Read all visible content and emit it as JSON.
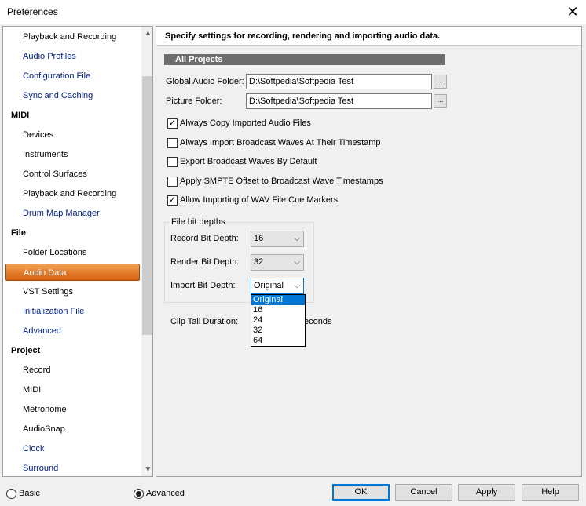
{
  "window": {
    "title": "Preferences",
    "close_glyph": "✕"
  },
  "tree": {
    "items": [
      {
        "label": "Playback and Recording",
        "kind": "sub",
        "color": "dark"
      },
      {
        "label": "Audio Profiles",
        "kind": "sub",
        "color": "blue"
      },
      {
        "label": "Configuration File",
        "kind": "sub",
        "color": "blue"
      },
      {
        "label": "Sync and Caching",
        "kind": "sub",
        "color": "blue"
      },
      {
        "label": "MIDI",
        "kind": "cat",
        "color": "dark"
      },
      {
        "label": "Devices",
        "kind": "sub",
        "color": "dark"
      },
      {
        "label": "Instruments",
        "kind": "sub",
        "color": "dark"
      },
      {
        "label": "Control Surfaces",
        "kind": "sub",
        "color": "dark"
      },
      {
        "label": "Playback and Recording",
        "kind": "sub",
        "color": "dark"
      },
      {
        "label": "Drum Map Manager",
        "kind": "sub",
        "color": "blue"
      },
      {
        "label": "File",
        "kind": "cat",
        "color": "dark"
      },
      {
        "label": "Folder Locations",
        "kind": "sub",
        "color": "dark"
      },
      {
        "label": "Audio Data",
        "kind": "sub",
        "color": "selected"
      },
      {
        "label": "VST Settings",
        "kind": "sub",
        "color": "dark"
      },
      {
        "label": "Initialization File",
        "kind": "sub",
        "color": "blue"
      },
      {
        "label": "Advanced",
        "kind": "sub",
        "color": "blue"
      },
      {
        "label": "Project",
        "kind": "cat",
        "color": "dark"
      },
      {
        "label": "Record",
        "kind": "sub",
        "color": "dark"
      },
      {
        "label": "MIDI",
        "kind": "sub",
        "color": "dark"
      },
      {
        "label": "Metronome",
        "kind": "sub",
        "color": "dark"
      },
      {
        "label": "AudioSnap",
        "kind": "sub",
        "color": "dark"
      },
      {
        "label": "Clock",
        "kind": "sub",
        "color": "blue"
      },
      {
        "label": "Surround",
        "kind": "sub",
        "color": "blue"
      }
    ],
    "scroll_up_icon": "▲",
    "scroll_down_icon": "▼"
  },
  "panel": {
    "header": "Specify settings for recording, rendering and importing audio data.",
    "section": "All Projects",
    "global_audio_folder": {
      "label": "Global Audio Folder:",
      "value": "D:\\Softpedia\\Softpedia Test"
    },
    "picture_folder": {
      "label": "Picture Folder:",
      "value": "D:\\Softpedia\\Softpedia Test"
    },
    "browse_label": "...",
    "checkboxes": [
      {
        "label": "Always Copy Imported Audio Files",
        "checked": true
      },
      {
        "label": "Always Import Broadcast Waves At Their Timestamp",
        "checked": false
      },
      {
        "label": "Export Broadcast Waves By Default",
        "checked": false
      },
      {
        "label": "Apply SMPTE Offset to Broadcast Wave Timestamps",
        "checked": false
      },
      {
        "label": "Allow Importing of WAV File Cue Markers",
        "checked": true
      }
    ],
    "check_glyph": "✓",
    "bit_depths": {
      "title": "File bit depths",
      "record": {
        "label": "Record Bit Depth:",
        "value": "16"
      },
      "render": {
        "label": "Render Bit Depth:",
        "value": "32"
      },
      "import": {
        "label": "Import Bit Depth:",
        "value": "Original"
      },
      "import_options": [
        "Original",
        "16",
        "24",
        "32",
        "64"
      ]
    },
    "clip_tail": {
      "label": "Clip Tail Duration:",
      "suffix": "econds"
    }
  },
  "footer": {
    "basic_label": "Basic",
    "advanced_label": "Advanced",
    "mode": "advanced",
    "ok": "OK",
    "cancel": "Cancel",
    "apply": "Apply",
    "help": "Help"
  }
}
